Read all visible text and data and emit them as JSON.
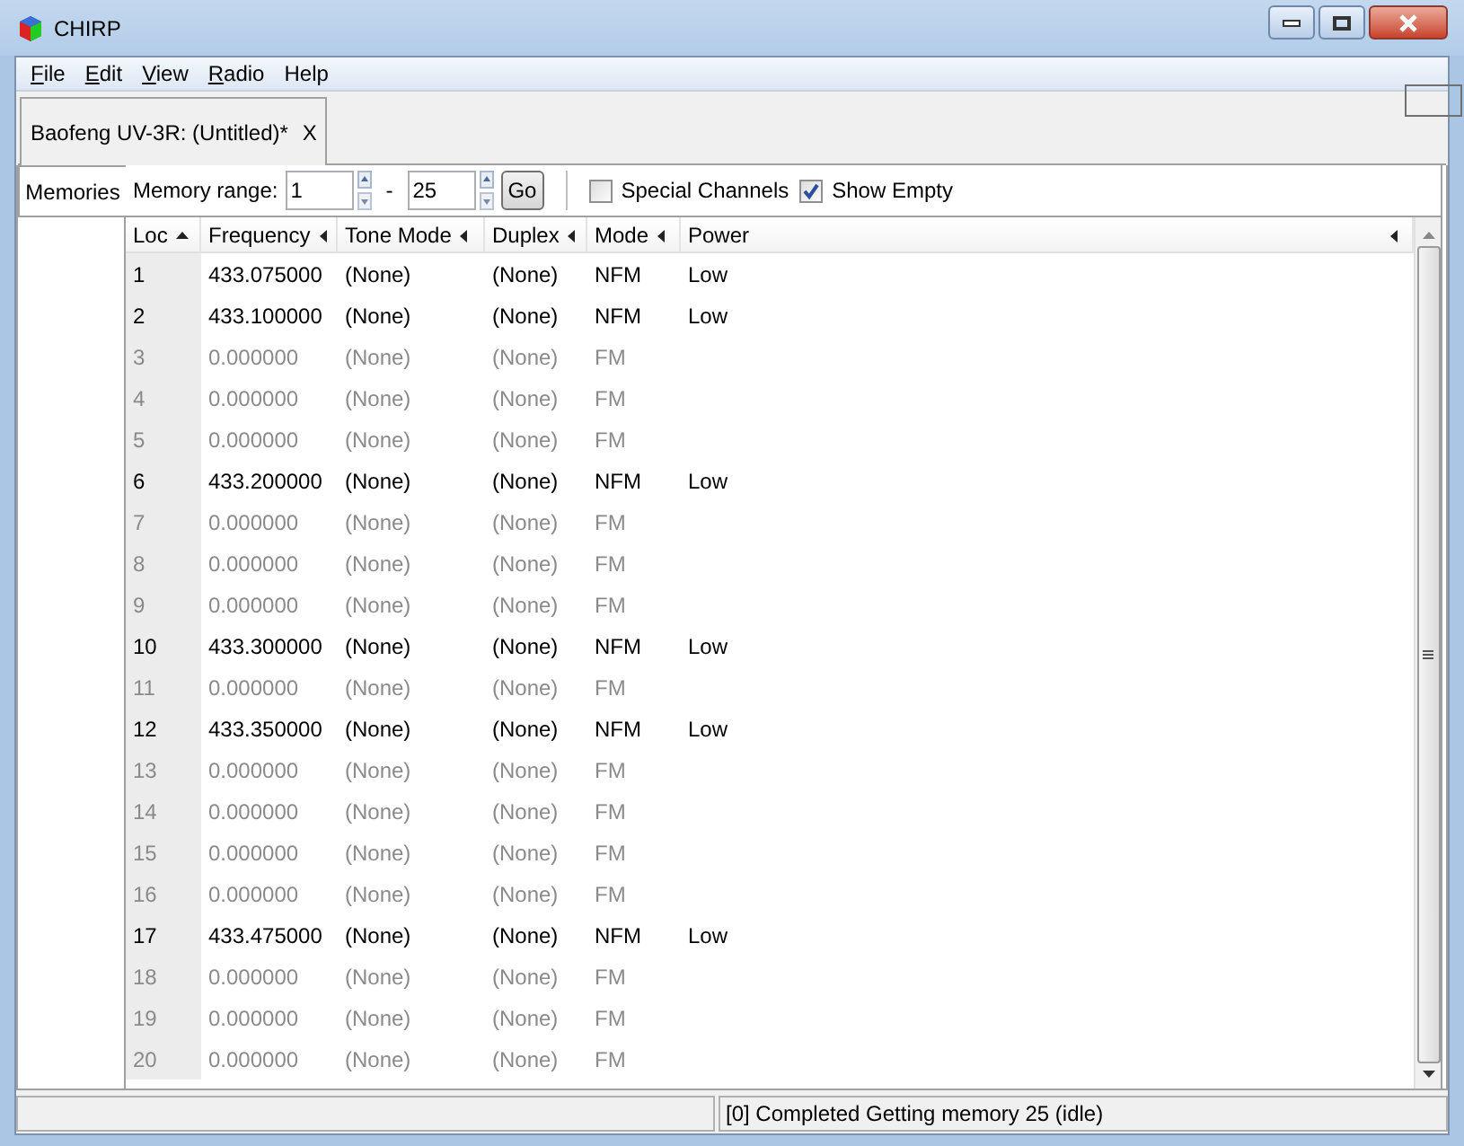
{
  "window": {
    "title": "CHIRP"
  },
  "menu": [
    {
      "label": "File",
      "mnemonic": true
    },
    {
      "label": "Edit",
      "mnemonic": true
    },
    {
      "label": "View",
      "mnemonic": true
    },
    {
      "label": "Radio",
      "mnemonic": true
    },
    {
      "label": "Help",
      "mnemonic": false
    }
  ],
  "tabs": [
    {
      "label": "Baofeng UV-3R: (Untitled)*",
      "close": "X",
      "selected": true
    }
  ],
  "side_tabs": [
    {
      "label": "Memories",
      "selected": true
    }
  ],
  "toolbar": {
    "range_label": "Memory range:",
    "range_start": "1",
    "range_separator": "-",
    "range_end": "25",
    "go": "Go",
    "checkboxes": [
      {
        "label": "Special Channels",
        "checked": false
      },
      {
        "label": "Show Empty",
        "checked": true
      }
    ]
  },
  "table": {
    "columns": [
      {
        "label": "Loc",
        "sorted": true
      },
      {
        "label": "Frequency",
        "sorted": false
      },
      {
        "label": "Tone Mode",
        "sorted": false
      },
      {
        "label": "Duplex",
        "sorted": false
      },
      {
        "label": "Mode",
        "sorted": false
      },
      {
        "label": "Power",
        "sorted": false
      }
    ],
    "rows": [
      {
        "loc": "1",
        "frequency": "433.075000",
        "tone_mode": "(None)",
        "duplex": "(None)",
        "mode": "NFM",
        "power": "Low",
        "empty": false
      },
      {
        "loc": "2",
        "frequency": "433.100000",
        "tone_mode": "(None)",
        "duplex": "(None)",
        "mode": "NFM",
        "power": "Low",
        "empty": false
      },
      {
        "loc": "3",
        "frequency": "0.000000",
        "tone_mode": "(None)",
        "duplex": "(None)",
        "mode": "FM",
        "empty": true
      },
      {
        "loc": "4",
        "frequency": "0.000000",
        "tone_mode": "(None)",
        "duplex": "(None)",
        "mode": "FM",
        "empty": true
      },
      {
        "loc": "5",
        "frequency": "0.000000",
        "tone_mode": "(None)",
        "duplex": "(None)",
        "mode": "FM",
        "empty": true
      },
      {
        "loc": "6",
        "frequency": "433.200000",
        "tone_mode": "(None)",
        "duplex": "(None)",
        "mode": "NFM",
        "power": "Low",
        "empty": false
      },
      {
        "loc": "7",
        "frequency": "0.000000",
        "tone_mode": "(None)",
        "duplex": "(None)",
        "mode": "FM",
        "empty": true
      },
      {
        "loc": "8",
        "frequency": "0.000000",
        "tone_mode": "(None)",
        "duplex": "(None)",
        "mode": "FM",
        "empty": true
      },
      {
        "loc": "9",
        "frequency": "0.000000",
        "tone_mode": "(None)",
        "duplex": "(None)",
        "mode": "FM",
        "empty": true
      },
      {
        "loc": "10",
        "frequency": "433.300000",
        "tone_mode": "(None)",
        "duplex": "(None)",
        "mode": "NFM",
        "power": "Low",
        "empty": false
      },
      {
        "loc": "11",
        "frequency": "0.000000",
        "tone_mode": "(None)",
        "duplex": "(None)",
        "mode": "FM",
        "empty": true
      },
      {
        "loc": "12",
        "frequency": "433.350000",
        "tone_mode": "(None)",
        "duplex": "(None)",
        "mode": "NFM",
        "power": "Low",
        "empty": false
      },
      {
        "loc": "13",
        "frequency": "0.000000",
        "tone_mode": "(None)",
        "duplex": "(None)",
        "mode": "FM",
        "empty": true
      },
      {
        "loc": "14",
        "frequency": "0.000000",
        "tone_mode": "(None)",
        "duplex": "(None)",
        "mode": "FM",
        "empty": true
      },
      {
        "loc": "15",
        "frequency": "0.000000",
        "tone_mode": "(None)",
        "duplex": "(None)",
        "mode": "FM",
        "empty": true
      },
      {
        "loc": "16",
        "frequency": "0.000000",
        "tone_mode": "(None)",
        "duplex": "(None)",
        "mode": "FM",
        "empty": true
      },
      {
        "loc": "17",
        "frequency": "433.475000",
        "tone_mode": "(None)",
        "duplex": "(None)",
        "mode": "NFM",
        "power": "Low",
        "empty": false
      },
      {
        "loc": "18",
        "frequency": "0.000000",
        "tone_mode": "(None)",
        "duplex": "(None)",
        "mode": "FM",
        "empty": true
      },
      {
        "loc": "19",
        "frequency": "0.000000",
        "tone_mode": "(None)",
        "duplex": "(None)",
        "mode": "FM",
        "empty": true
      },
      {
        "loc": "20",
        "frequency": "0.000000",
        "tone_mode": "(None)",
        "duplex": "(None)",
        "mode": "FM",
        "empty": true
      }
    ]
  },
  "status_bar": {
    "right": "[0] Completed Getting memory 25 (idle)"
  }
}
